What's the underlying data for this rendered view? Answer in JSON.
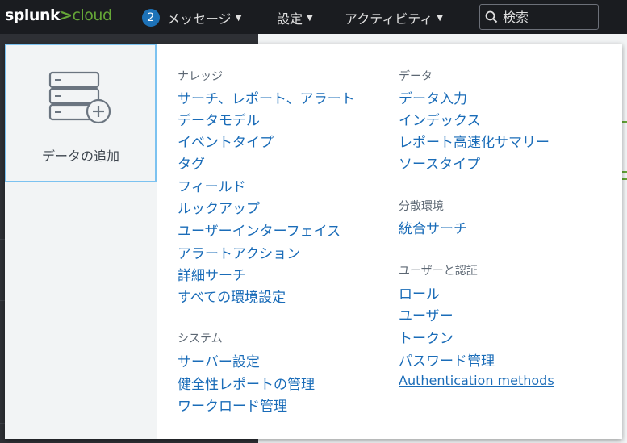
{
  "header": {
    "logo_main": "splunk",
    "logo_gt": ">",
    "logo_cloud": "cloud",
    "messages_count": "2",
    "messages_label": "メッセージ",
    "settings_label": "設定",
    "activity_label": "アクティビティ",
    "search_placeholder": "検索",
    "caret": "▼"
  },
  "dropdown": {
    "add_data_label": "データの追加",
    "knowledge": {
      "title": "ナレッジ",
      "items": [
        "サーチ、レポート、アラート",
        "データモデル",
        "イベントタイプ",
        "タグ",
        "フィールド",
        "ルックアップ",
        "ユーザーインターフェイス",
        "アラートアクション",
        "詳細サーチ",
        "すべての環境設定"
      ]
    },
    "system": {
      "title": "システム",
      "items": [
        "サーバー設定",
        "健全性レポートの管理",
        "ワークロード管理"
      ]
    },
    "data": {
      "title": "データ",
      "items": [
        "データ入力",
        "インデックス",
        "レポート高速化サマリー",
        "ソースタイプ"
      ]
    },
    "distributed": {
      "title": "分散環境",
      "items": [
        "統合サーチ"
      ]
    },
    "users_auth": {
      "title": "ユーザーと認証",
      "items": [
        "ロール",
        "ユーザー",
        "トークン",
        "パスワード管理",
        "Authentication methods"
      ]
    }
  },
  "colors": {
    "link": "#1a6cb8",
    "accent_green": "#65a637",
    "badge_blue": "#1d72b8",
    "tile_border": "#7cc2f0"
  }
}
